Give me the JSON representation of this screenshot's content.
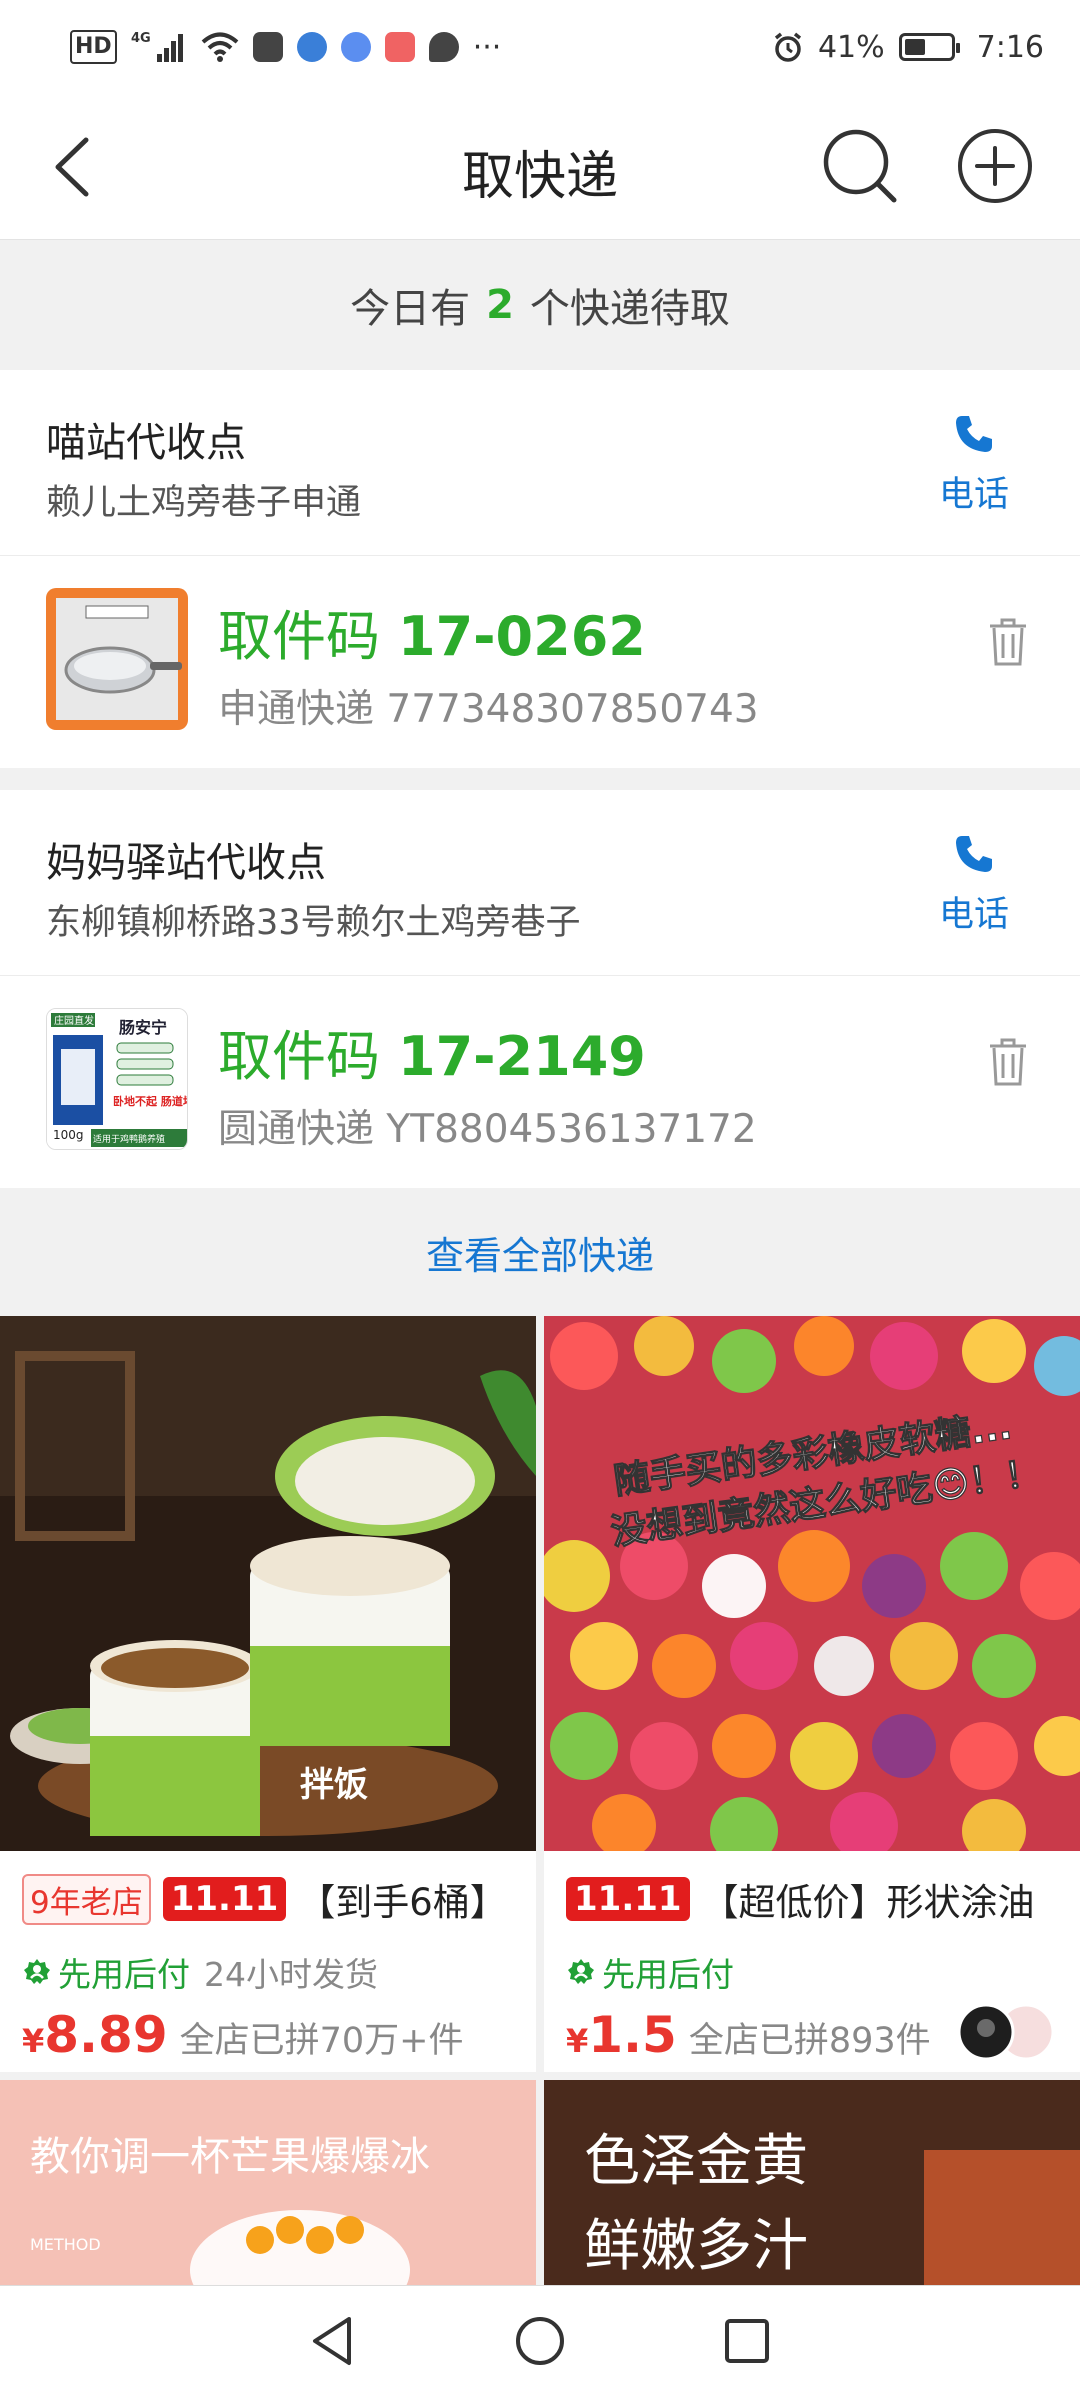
{
  "status_bar": {
    "network": "HD",
    "signal": "4G",
    "battery_percent": "41%",
    "time": "7:16",
    "more": "···"
  },
  "header": {
    "title": "取快递",
    "icons": [
      "back-icon",
      "search-icon",
      "add-icon"
    ]
  },
  "summary": {
    "prefix": "今日有",
    "count": "2",
    "suffix": "个快递待取"
  },
  "stations": [
    {
      "name": "喵站代收点",
      "address": "赖儿土鸡旁巷子申通",
      "phone_label": "电话",
      "parcel": {
        "code_label": "取件码",
        "code": "17-0262",
        "courier": "申通快递",
        "tracking": "777348307850743"
      }
    },
    {
      "name": "妈妈驿站代收点",
      "address": "东柳镇柳桥路33号赖尔土鸡旁巷子",
      "phone_label": "电话",
      "parcel": {
        "code_label": "取件码",
        "code": "17-2149",
        "courier": "圆通快递",
        "tracking": "YT8804536137172",
        "thumb_text": {
          "tag": "庄园直发",
          "brand": "肠安宁",
          "weight": "100g",
          "red_text": "卧地不起 肠道坏死",
          "footer": "适用于鸡鸭鹅养殖"
        }
      }
    }
  ],
  "view_all": "查看全部快递",
  "products": [
    {
      "badge_old": "9年老店",
      "badge_sale": "11.11",
      "title": "【到手6桶】",
      "pay_later": "先用后付",
      "ship": "24小时发货",
      "currency": "¥",
      "price": "8.89",
      "sold": "全店已拼70万+件",
      "image_text": "拌饭"
    },
    {
      "badge_sale": "11.11",
      "title": "【超低价】形状涂油",
      "pay_later": "先用后付",
      "currency": "¥",
      "price": "1.5",
      "sold": "全店已拼893件",
      "image_text_line1": "随手买的多彩橡皮软糖...",
      "image_text_line2": "没想到竟然这么好吃😊！！"
    }
  ],
  "products_more": [
    {
      "image_text": "教你调一杯芒果爆爆冰",
      "small": "METHOD"
    },
    {
      "image_text_line1": "色泽金黄",
      "image_text_line2": "鲜嫩多汁"
    }
  ],
  "colors": {
    "green": "#2cab2c",
    "blue": "#1677d2",
    "red": "#e8362f"
  }
}
